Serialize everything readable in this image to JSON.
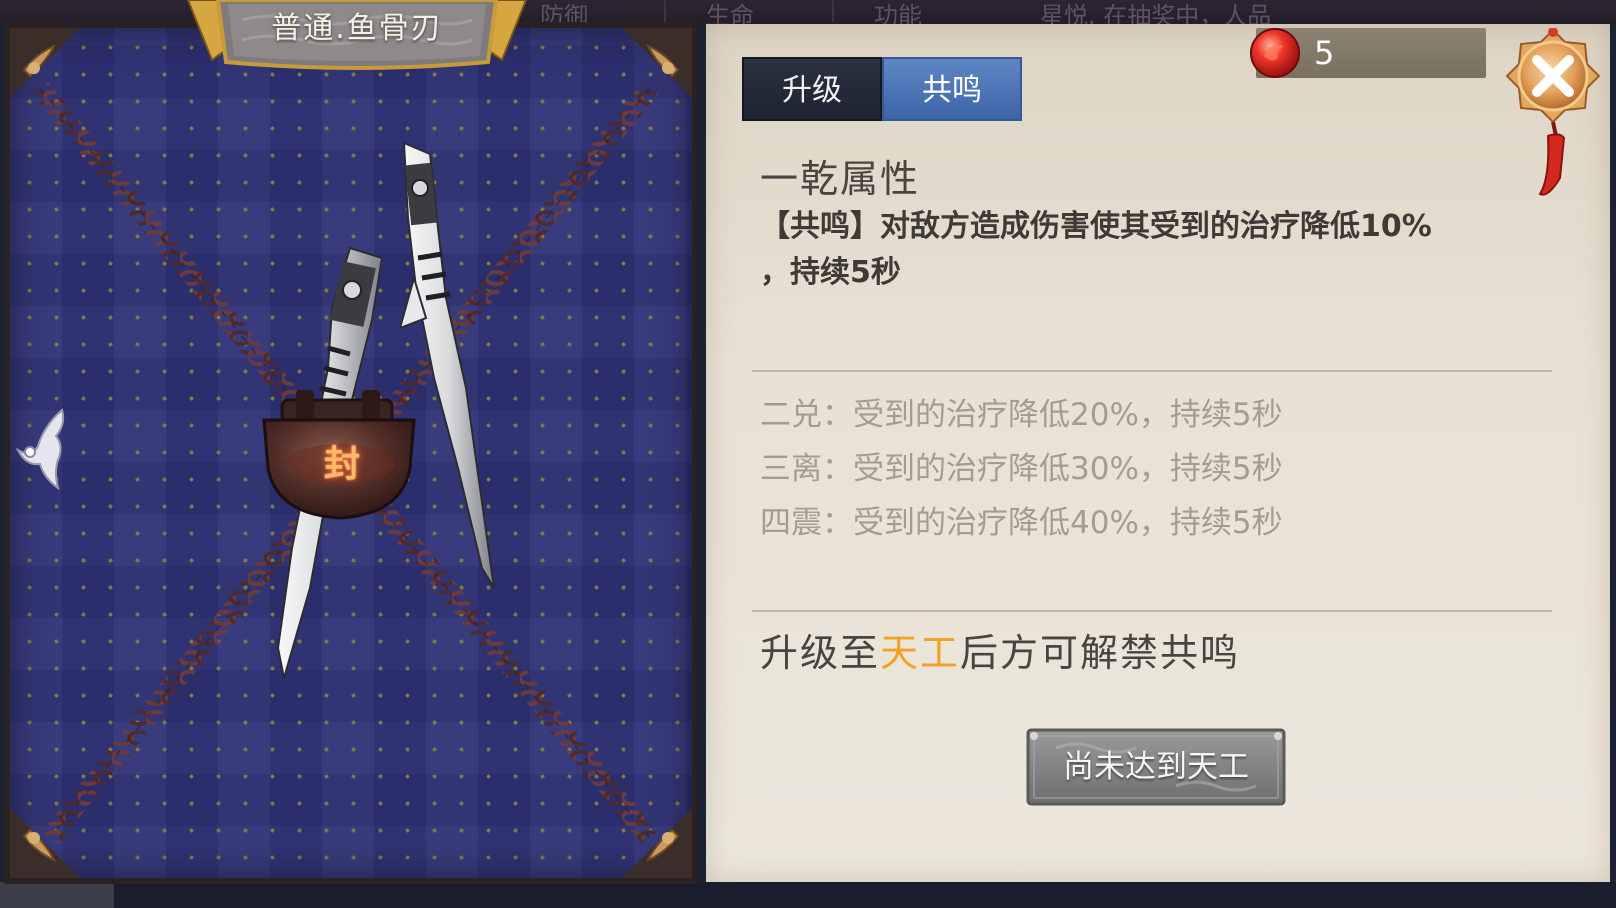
{
  "background_tabs": [
    "防御",
    "生命",
    "功能"
  ],
  "background_notice": "星悦. 在抽奖中，人品",
  "weapon": {
    "title": "普通.鱼骨刃",
    "seal_char": "封"
  },
  "tabs": [
    {
      "label": "升级",
      "active": false
    },
    {
      "label": "共鸣",
      "active": true
    }
  ],
  "currency": {
    "icon": "red-orb-icon",
    "value": "5"
  },
  "resonance": {
    "title": "一乾属性",
    "description_line1": "【共鸣】对敌方造成伤害使其受到的治疗降低10%",
    "description_line2": "，持续5秒",
    "tiers": [
      "二兑：受到的治疗降低20%，持续5秒",
      "三离：受到的治疗降低30%，持续5秒",
      "四震：受到的治疗降低40%，持续5秒"
    ]
  },
  "unlock": {
    "prefix": "升级至",
    "highlight": "天工",
    "suffix": "后方可解禁共鸣"
  },
  "action_button": {
    "label": "尚未达到天工"
  },
  "colors": {
    "highlight": "#f4a023",
    "active_tab": "#4c73b6",
    "inactive_tab": "#242a36",
    "panel_bg": "#e6e0d3"
  }
}
